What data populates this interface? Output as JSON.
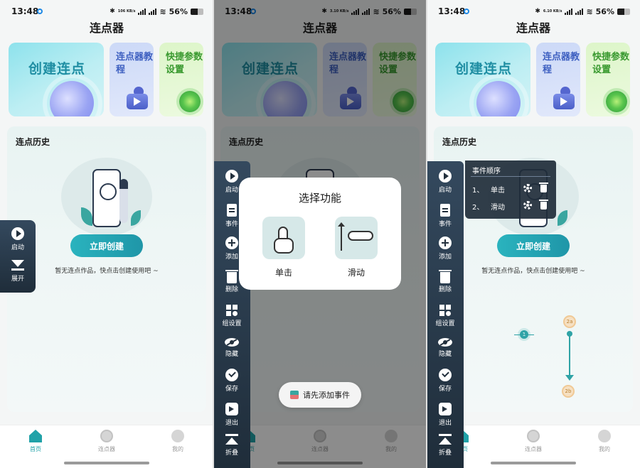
{
  "status": {
    "time": "13:48",
    "battery": "56%",
    "speed_p1": "106 KB/s",
    "speed_p2": "3.10 KB/s",
    "speed_p3": "6.10 KB/s",
    "network": "5G"
  },
  "app": {
    "title": "连点器"
  },
  "banners": {
    "create": "创建连点",
    "tutorial": "连点器教程",
    "settings": "快捷参数设置"
  },
  "history": {
    "title": "连点历史",
    "create_button": "立即创建",
    "empty_text": "暂无连点作品，快点击创建使用吧 ~"
  },
  "nav": {
    "home": "首页",
    "clicker": "连点器",
    "mine": "我的"
  },
  "mini_toolbar": {
    "start": "启动",
    "expand": "展开"
  },
  "toolbar": {
    "start": "启动",
    "events": "事件",
    "add": "添加",
    "delete": "删除",
    "group_settings": "组设置",
    "hide": "隐藏",
    "save": "保存",
    "exit": "退出",
    "collapse": "折叠"
  },
  "dialog": {
    "title": "选择功能",
    "single": "单击",
    "swipe": "滑动"
  },
  "toast": {
    "text": "请先添加事件"
  },
  "event_panel": {
    "title": "事件顺序",
    "rows": [
      {
        "index": "1、",
        "name": "单击"
      },
      {
        "index": "2、",
        "name": "滑动"
      }
    ]
  },
  "markers": {
    "m1": "1",
    "m2a": "2a",
    "m2b": "2b"
  },
  "colors": {
    "accent": "#21a2a8",
    "toolbar": "#2b3b4c"
  }
}
